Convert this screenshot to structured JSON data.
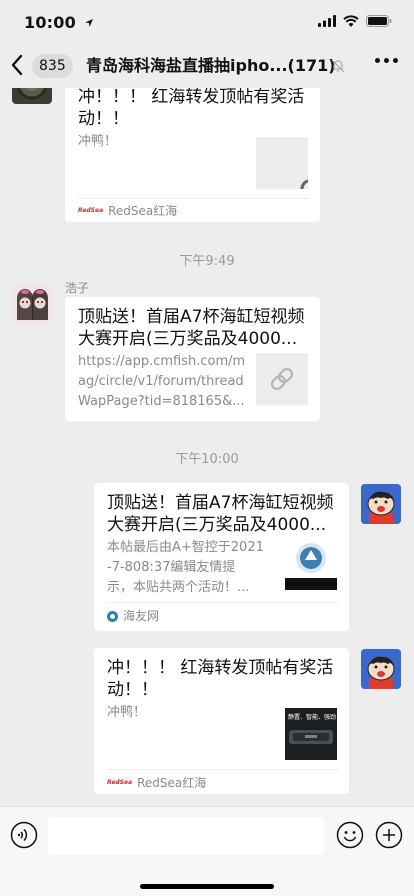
{
  "status_bar": {
    "time": "10:00"
  },
  "nav": {
    "back_badge": "835",
    "title": "青岛海科海盐直播抽ipho...(171)"
  },
  "messages": [
    {
      "card_title_lines": [
        "冲！！！ 红海转发顶帖有奖活",
        "动！！"
      ],
      "card_desc_lines": [
        "冲鸭！"
      ],
      "source": "RedSea红海",
      "source_logo_text": "RedSea"
    },
    {
      "timestamp": "下午9:49"
    },
    {
      "sender": "浩子",
      "card_title_lines": [
        "顶贴送！首届A7杯海缸短视频",
        "大赛开启(三万奖品及4000..."
      ],
      "card_desc_lines": [
        "https://app.cmfish.com/m",
        "ag/circle/v1/forum/thread",
        "WapPage?tid=818165&..."
      ]
    },
    {
      "timestamp": "下午10:00"
    },
    {
      "card_title_lines": [
        "顶贴送！首届A7杯海缸短视频",
        "大赛开启(三万奖品及4000..."
      ],
      "card_desc_lines": [
        "本帖最后由A+智控于2021",
        "-7-808:37编辑友情提",
        "示，本贴共两个活动！..."
      ],
      "source": "海友网"
    },
    {
      "card_title_lines": [
        "冲！！！ 红海转发顶帖有奖活",
        "动！！"
      ],
      "card_desc_lines": [
        "冲鸭！"
      ],
      "source": "RedSea红海",
      "source_logo_text": "RedSea",
      "thumb_text": "静置、智能、强劲"
    }
  ],
  "input": {
    "placeholder": ""
  },
  "colors": {
    "background": "#ededed",
    "card": "#ffffff",
    "redsea": "#c0302e",
    "haiyou": "#2b7bb5",
    "avatar_blue": "#3b69c9"
  }
}
